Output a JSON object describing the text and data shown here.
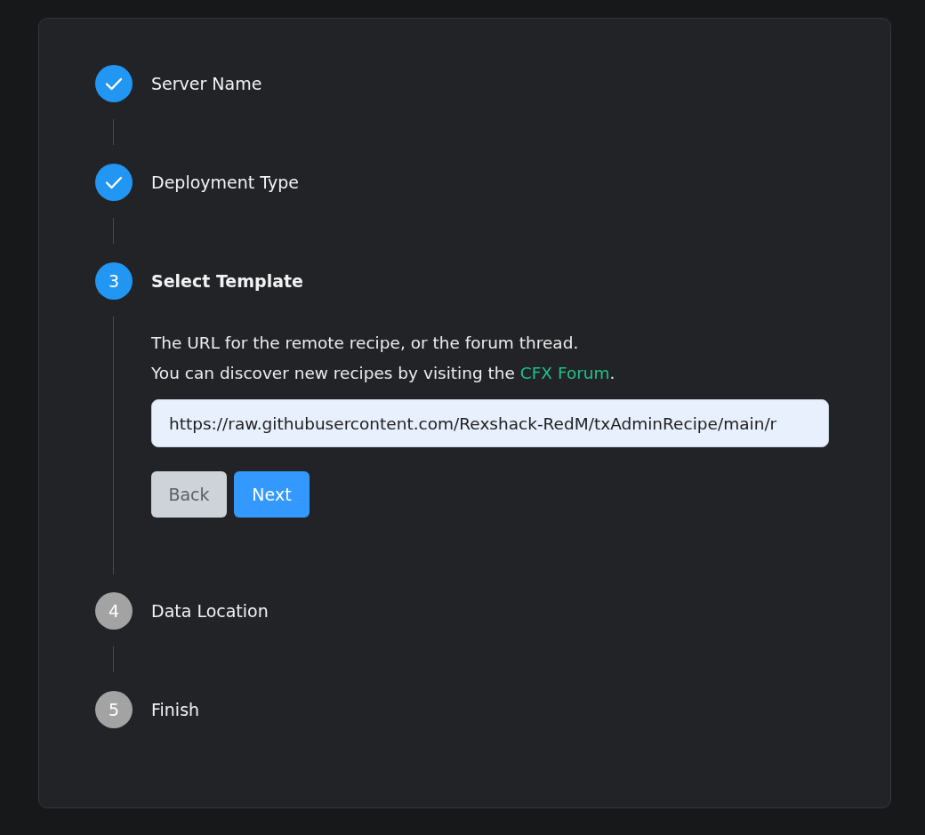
{
  "steps": [
    {
      "label": "Server Name",
      "completed": true,
      "selected": false
    },
    {
      "label": "Deployment Type",
      "completed": true,
      "selected": false
    },
    {
      "number": "3",
      "label": "Select Template",
      "completed": false,
      "selected": true,
      "content": {
        "description": "The URL for the remote recipe, or the forum thread.",
        "hint": {
          "text_before": "You can discover new recipes by visiting the ",
          "link": "CFX Forum",
          "text_after": "."
        },
        "url_field": {
          "value": "https://raw.githubusercontent.com/Rexshack-RedM/txAdminRecipe/main/r"
        },
        "buttons": [
          {
            "label": "Back",
            "kind": "secondary"
          },
          {
            "label": "Next",
            "kind": "primary"
          }
        ]
      }
    },
    {
      "number": "4",
      "label": "Data Location",
      "completed": false,
      "selected": false
    },
    {
      "number": "5",
      "label": "Finish",
      "completed": false,
      "selected": false
    }
  ]
}
